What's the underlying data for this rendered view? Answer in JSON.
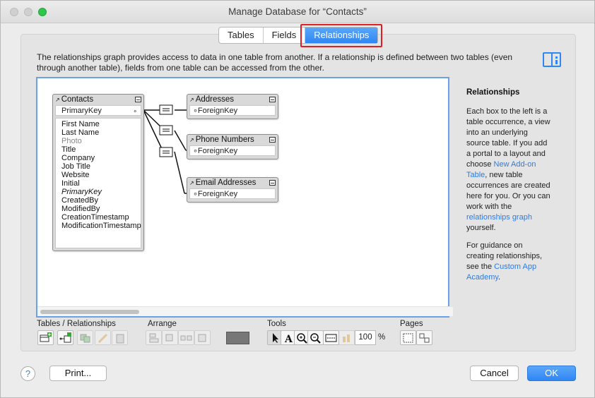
{
  "window": {
    "title": "Manage Database for “Contacts”"
  },
  "tabs": [
    {
      "label": "Tables",
      "active": false
    },
    {
      "label": "Fields",
      "active": false
    },
    {
      "label": "Relationships",
      "active": true
    }
  ],
  "description": "The relationships graph provides access to data in one table from another. If a relationship is defined between two tables (even through another table), fields from one table can be accessed from the other.",
  "graph": {
    "contacts": {
      "name": "Contacts",
      "key": "PrimaryKey",
      "fields": [
        "First Name",
        "Last Name",
        "Photo",
        "Title",
        "Company",
        "Job Title",
        "Website",
        "Initial",
        "PrimaryKey",
        "CreatedBy",
        "ModifiedBy",
        "CreationTimestamp",
        "ModificationTimestamp"
      ]
    },
    "addresses": {
      "name": "Addresses",
      "key": "ForeignKey"
    },
    "phone": {
      "name": "Phone Numbers",
      "key": "ForeignKey"
    },
    "email": {
      "name": "Email Addresses",
      "key": "ForeignKey"
    }
  },
  "sidebar": {
    "title": "Relationships",
    "p1": {
      "before": "Each box to the left is a table occurrence, a view into an underlying source table. If you add a portal to a layout and choose ",
      "link1": "New Add-on Table",
      "middle": ", new table occurrences are created here for you. Or you can work with the ",
      "link2": "relationships graph",
      "after": " yourself."
    },
    "p2": {
      "before": "For guidance on creating relationships, see the ",
      "link": "Custom App Academy",
      "after": "."
    }
  },
  "toolbar": {
    "groups": [
      "Tables / Relationships",
      "Arrange",
      "Tools",
      "Pages"
    ],
    "zoom": "100",
    "zoom_unit": "%",
    "swatch_color": "#777777"
  },
  "buttons": {
    "help": "?",
    "print": "Print...",
    "cancel": "Cancel",
    "ok": "OK"
  }
}
